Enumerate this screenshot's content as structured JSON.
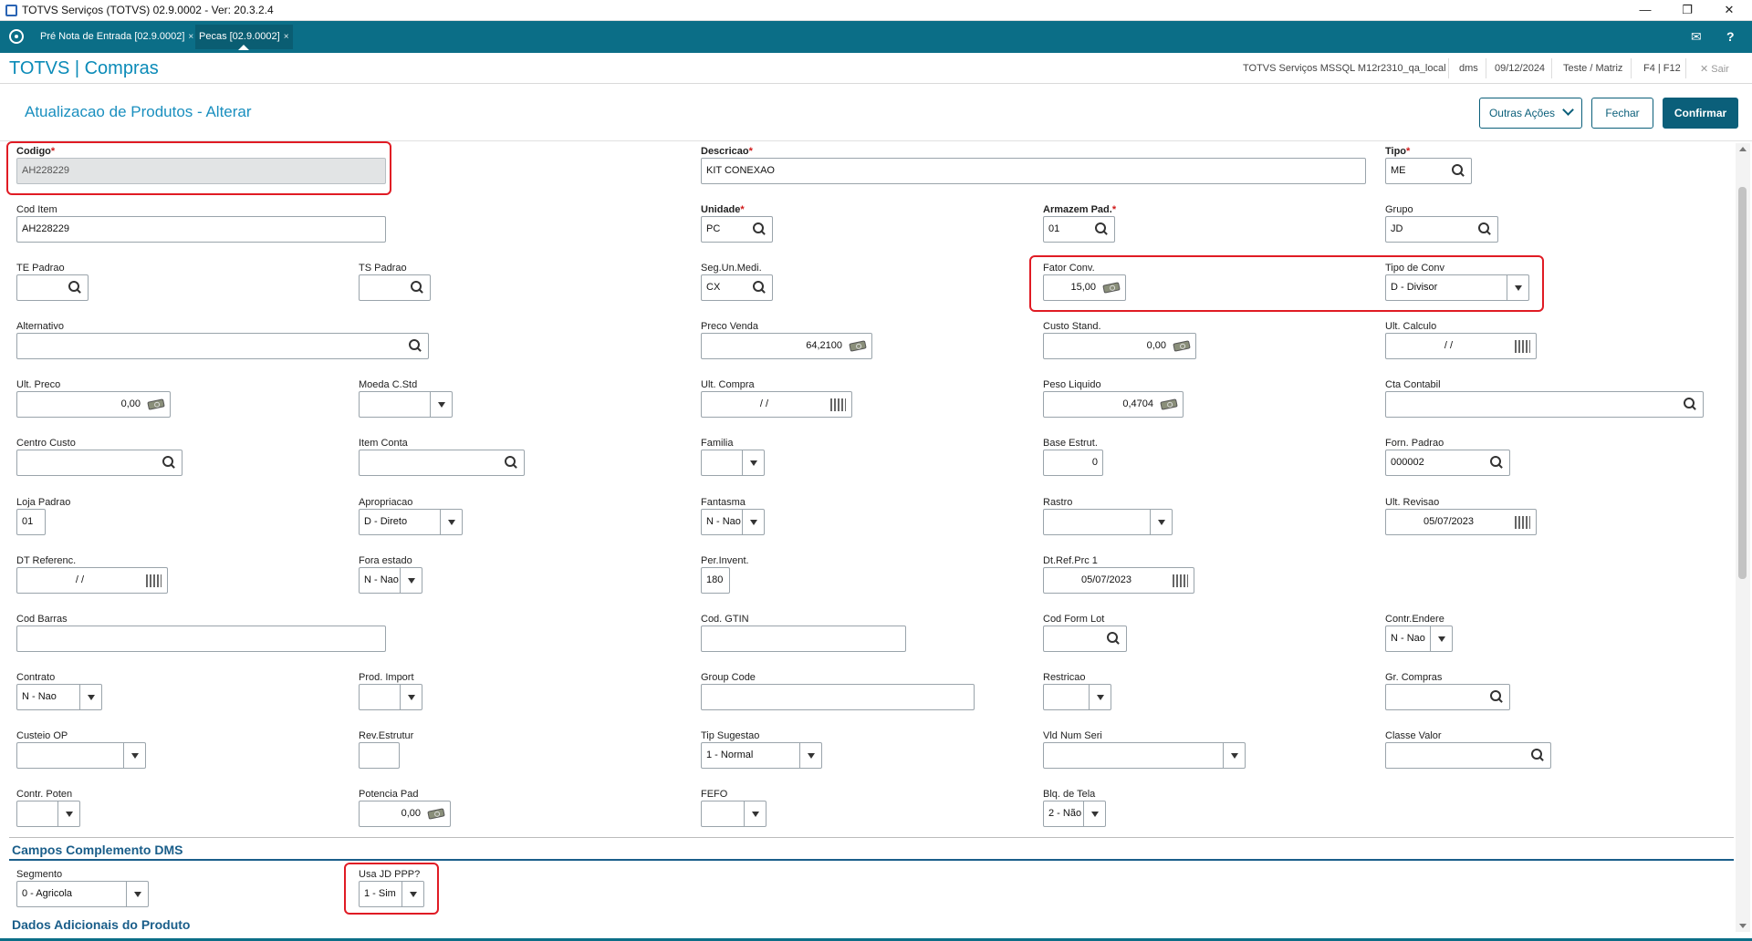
{
  "window": {
    "title": "TOTVS Serviços (TOTVS) 02.9.0002 - Ver: 20.3.2.4"
  },
  "tabs": [
    {
      "label": "Pré Nota de Entrada [02.9.0002]",
      "close": "×"
    },
    {
      "label": "Pecas [02.9.0002]",
      "close": "×"
    }
  ],
  "header": {
    "brand": "TOTVS | Compras",
    "server": "TOTVS Serviços MSSQL M12r2310_qa_local",
    "user": "dms",
    "date": "09/12/2024",
    "company": "Teste / Matriz",
    "shortcuts": "F4 | F12",
    "exit": "Sair"
  },
  "page": {
    "title": "Atualizacao de Produtos - Alterar",
    "buttons": {
      "more": "Outras Ações",
      "close": "Fechar",
      "confirm": "Confirmar"
    }
  },
  "fields": {
    "codigo": {
      "label": "Codigo",
      "value": "AH228229"
    },
    "descricao": {
      "label": "Descricao",
      "value": "KIT CONEXAO"
    },
    "tipo": {
      "label": "Tipo",
      "value": "ME"
    },
    "cod_item": {
      "label": "Cod Item",
      "value": "AH228229"
    },
    "unidade": {
      "label": "Unidade",
      "value": "PC"
    },
    "armazem": {
      "label": "Armazem Pad.",
      "value": "01"
    },
    "grupo": {
      "label": "Grupo",
      "value": "JD"
    },
    "te_padrao": {
      "label": "TE Padrao",
      "value": ""
    },
    "ts_padrao": {
      "label": "TS Padrao",
      "value": ""
    },
    "seg_un": {
      "label": "Seg.Un.Medi.",
      "value": "CX"
    },
    "fator_conv": {
      "label": "Fator Conv.",
      "value": "15,00"
    },
    "tipo_conv": {
      "label": "Tipo de Conv",
      "value": "D - Divisor"
    },
    "alternativo": {
      "label": "Alternativo",
      "value": ""
    },
    "preco_venda": {
      "label": "Preco Venda",
      "value": "64,2100"
    },
    "custo_stand": {
      "label": "Custo Stand.",
      "value": "0,00"
    },
    "ult_calculo": {
      "label": "Ult. Calculo",
      "value": "/ /"
    },
    "ult_preco": {
      "label": "Ult. Preco",
      "value": "0,00"
    },
    "moeda_cstd": {
      "label": "Moeda C.Std",
      "value": ""
    },
    "ult_compra": {
      "label": "Ult. Compra",
      "value": "/ /"
    },
    "peso_liquido": {
      "label": "Peso Liquido",
      "value": "0,4704"
    },
    "cta_contabil": {
      "label": "Cta Contabil",
      "value": ""
    },
    "centro_custo": {
      "label": "Centro Custo",
      "value": ""
    },
    "item_conta": {
      "label": "Item Conta",
      "value": ""
    },
    "familia": {
      "label": "Familia",
      "value": ""
    },
    "base_estrut": {
      "label": "Base Estrut.",
      "value": "0"
    },
    "forn_padrao": {
      "label": "Forn. Padrao",
      "value": "000002"
    },
    "loja_padrao": {
      "label": "Loja Padrao",
      "value": "01"
    },
    "apropriacao": {
      "label": "Apropriacao",
      "value": "D - Direto"
    },
    "fantasma": {
      "label": "Fantasma",
      "value": "N - Nao"
    },
    "rastro": {
      "label": "Rastro",
      "value": ""
    },
    "ult_revisao": {
      "label": "Ult. Revisao",
      "value": "05/07/2023"
    },
    "dt_referenc": {
      "label": "DT Referenc.",
      "value": "/ /"
    },
    "fora_estado": {
      "label": "Fora estado",
      "value": "N - Nao"
    },
    "per_invent": {
      "label": "Per.Invent.",
      "value": "180"
    },
    "dt_ref_prc": {
      "label": "Dt.Ref.Prc 1",
      "value": "05/07/2023"
    },
    "cod_barras": {
      "label": "Cod Barras",
      "value": ""
    },
    "cod_gtin": {
      "label": "Cod. GTIN",
      "value": ""
    },
    "cod_form_lot": {
      "label": "Cod Form Lot",
      "value": ""
    },
    "contr_endere": {
      "label": "Contr.Endere",
      "value": "N - Nao"
    },
    "contrato": {
      "label": "Contrato",
      "value": "N - Nao"
    },
    "prod_import": {
      "label": "Prod. Import",
      "value": ""
    },
    "group_code": {
      "label": "Group Code",
      "value": ""
    },
    "restricao": {
      "label": "Restricao",
      "value": ""
    },
    "gr_compras": {
      "label": "Gr. Compras",
      "value": ""
    },
    "custeio_op": {
      "label": "Custeio OP",
      "value": ""
    },
    "rev_estrutur": {
      "label": "Rev.Estrutur",
      "value": ""
    },
    "tip_sugestao": {
      "label": "Tip Sugestao",
      "value": "1 - Normal"
    },
    "vld_num_seri": {
      "label": "Vld Num Seri",
      "value": ""
    },
    "classe_valor": {
      "label": "Classe Valor",
      "value": ""
    },
    "contr_poten": {
      "label": "Contr. Poten",
      "value": ""
    },
    "potencia_pad": {
      "label": "Potencia Pad",
      "value": "0,00"
    },
    "fefo": {
      "label": "FEFO",
      "value": ""
    },
    "blq_tela": {
      "label": "Blq. de Tela",
      "value": "2 - Não"
    }
  },
  "sections": {
    "dms": "Campos Complemento DMS",
    "adicionais": "Dados Adicionais do Produto"
  },
  "dms": {
    "segmento": {
      "label": "Segmento",
      "value": "0 - Agricola"
    },
    "usa_jd_ppp": {
      "label": "Usa JD PPP?",
      "value": "1 - Sim"
    }
  },
  "colors": {
    "accent": "#0b6e87",
    "brand": "#0b8bb8",
    "highlight": "#e01b24",
    "section": "#1a5e8a"
  },
  "icons": [
    "search-icon",
    "money-icon",
    "calendar-icon",
    "mail-icon",
    "help-icon",
    "close-icon"
  ]
}
